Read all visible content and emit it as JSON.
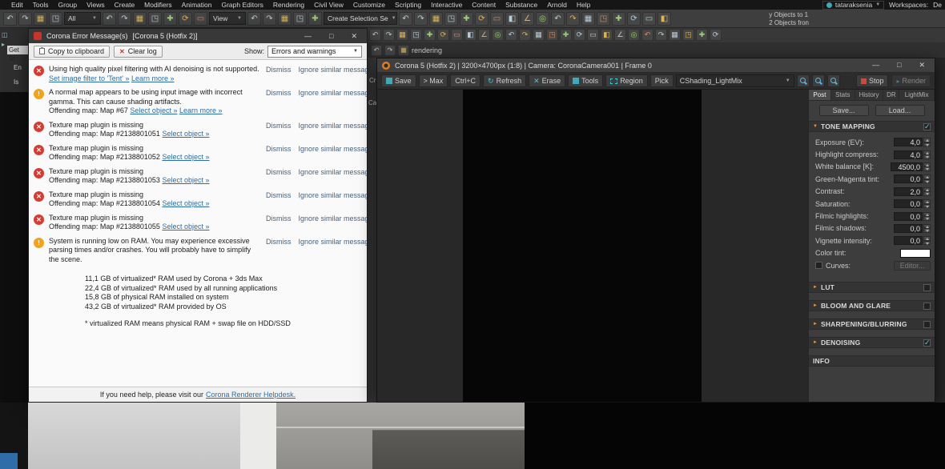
{
  "colors": {
    "accent_teal": "#3fa9b8",
    "corona_orange": "#e87b1e",
    "error_red": "#d63c31",
    "warning_yellow": "#f0a31b",
    "link_blue": "#2e6da4"
  },
  "menubar": {
    "items": [
      "Edit",
      "Tools",
      "Group",
      "Views",
      "Create",
      "Modifiers",
      "Animation",
      "Graph Editors",
      "Rendering",
      "Civil View",
      "Customize",
      "Scripting",
      "Interactive",
      "Content",
      "Substance",
      "Arnold",
      "Help"
    ],
    "user": "tataraksenia",
    "workspaces_label": "Workspaces:",
    "workspaces_value": "De"
  },
  "toolbar": {
    "selection_filter_value": "All",
    "coord_system_value": "View",
    "named_selection_value": "Create Selection Se",
    "right_fragment_top": "y Objects to 1",
    "right_fragment_bottom": "2 Objects fron"
  },
  "background_fragments": {
    "rendering": "rendering",
    "cr": "Cr",
    "ca": "Ca",
    "get_st": "Get St",
    "en": "En",
    "is": "Is"
  },
  "error_dialog": {
    "title": "Corona Error Message(s)",
    "title_suffix": "[Corona 5 (Hotfix 2)]",
    "toolbar": {
      "copy_button": "Copy to clipboard",
      "clear_button": "Clear log",
      "show_label": "Show:",
      "show_value": "Errors and warnings"
    },
    "dismiss_label": "Dismiss",
    "ignore_label": "Ignore similar messages",
    "rows": [
      {
        "severity": "error",
        "text": "Using high quality pixel filtering with AI denoising is not supported.",
        "links": [
          "Set image filter to 'Tent' »",
          "Learn more »"
        ]
      },
      {
        "severity": "warning",
        "text": "A normal map appears to be using input image with incorrect gamma. This can cause shading artifacts.",
        "line2": "Offending map: Map #67",
        "links": [
          "Select object »",
          "Learn more »"
        ]
      },
      {
        "severity": "error",
        "text": "Texture map plugin is missing",
        "line2": "Offending map: Map #2138801051",
        "links": [
          "Select object »"
        ]
      },
      {
        "severity": "error",
        "text": "Texture map plugin is missing",
        "line2": "Offending map: Map #2138801052",
        "links": [
          "Select object »"
        ]
      },
      {
        "severity": "error",
        "text": "Texture map plugin is missing",
        "line2": "Offending map: Map #2138801053",
        "links": [
          "Select object »"
        ]
      },
      {
        "severity": "error",
        "text": "Texture map plugin is missing",
        "line2": "Offending map: Map #2138801054",
        "links": [
          "Select object »"
        ]
      },
      {
        "severity": "error",
        "text": "Texture map plugin is missing",
        "line2": "Offending map: Map #2138801055",
        "links": [
          "Select object »"
        ]
      },
      {
        "severity": "warning",
        "text": "System is running low on RAM. You may experience excessive parsing times and/or crashes. You will probably have to simplify the scene.",
        "links": []
      }
    ],
    "ram_lines": [
      "11,1 GB of virtualized* RAM used by Corona + 3ds Max",
      "22,4 GB of virtualized* RAM used by all running applications",
      "15,8 GB of physical RAM installed on system",
      "43,2 GB of virtualized* RAM provided by OS"
    ],
    "ram_note": "* virtualized RAM means physical RAM + swap file on HDD/SSD",
    "footer_text": "If you need help, please visit our",
    "footer_link": "Corona Renderer Helpdesk."
  },
  "vfb": {
    "title": "Corona 5 (Hotfix 2) | 3200×4700px (1:8) | Camera: CoronaCamera001 | Frame 0",
    "toolbar": {
      "save": "Save",
      "max": "> Max",
      "copy": "Ctrl+C",
      "refresh": "Refresh",
      "erase": "Erase",
      "tools": "Tools",
      "region": "Region",
      "pick": "Pick",
      "lightmix_value": "CShading_LightMix",
      "stop": "Stop",
      "render": "Render"
    },
    "tabs": [
      "Post",
      "Stats",
      "History",
      "DR",
      "LightMix"
    ],
    "save_button": "Save...",
    "load_button": "Load...",
    "tone_mapping": {
      "title": "TONE MAPPING",
      "enabled": true,
      "params": [
        {
          "label": "Exposure (EV):",
          "value": "4,0"
        },
        {
          "label": "Highlight compress:",
          "value": "4,0"
        },
        {
          "label": "White balance [K]:",
          "value": "4500,0"
        },
        {
          "label": "Green-Magenta tint:",
          "value": "0,0"
        },
        {
          "label": "Contrast:",
          "value": "2,0"
        },
        {
          "label": "Saturation:",
          "value": "0,0"
        },
        {
          "label": "Filmic highlights:",
          "value": "0,0"
        },
        {
          "label": "Filmic shadows:",
          "value": "0,0"
        },
        {
          "label": "Vignette intensity:",
          "value": "0,0"
        }
      ],
      "color_tint_label": "Color tint:",
      "color_tint_value": "#ffffff",
      "curves_label": "Curves:",
      "curves_enabled": false,
      "editor_button": "Editor..."
    },
    "sections": [
      {
        "title": "LUT",
        "enabled": false
      },
      {
        "title": "BLOOM AND GLARE",
        "enabled": false
      },
      {
        "title": "SHARPENING/BLURRING",
        "enabled": false
      },
      {
        "title": "DENOISING",
        "enabled": true
      }
    ],
    "info_title": "INFO"
  }
}
